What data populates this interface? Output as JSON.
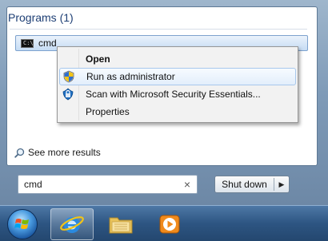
{
  "start_menu": {
    "programs_header": "Programs (1)",
    "programs": [
      {
        "label": "cmd",
        "icon": "cmd-icon"
      }
    ],
    "see_more": "See more results",
    "search": {
      "value": "cmd",
      "clear_symbol": "×"
    },
    "shutdown": {
      "label": "Shut down",
      "arrow": "▶"
    }
  },
  "context_menu": {
    "items": [
      {
        "label": "Open",
        "bold": true,
        "icon": ""
      },
      {
        "label": "Run as administrator",
        "icon": "uac-shield-icon",
        "highlighted": true
      },
      {
        "label": "Scan with Microsoft Security Essentials...",
        "icon": "security-essentials-icon"
      },
      {
        "label": "Properties",
        "icon": ""
      }
    ]
  },
  "taskbar": {
    "items": [
      {
        "name": "start-button",
        "icon": "windows-orb-icon"
      },
      {
        "name": "internet-explorer",
        "icon": "internet-explorer-icon"
      },
      {
        "name": "windows-explorer",
        "icon": "folder-icon"
      },
      {
        "name": "windows-media-player",
        "icon": "media-player-icon"
      }
    ]
  },
  "colors": {
    "header_text": "#1e3f75",
    "highlight_border": "#7da2ce",
    "taskbar": "#2d5582"
  }
}
